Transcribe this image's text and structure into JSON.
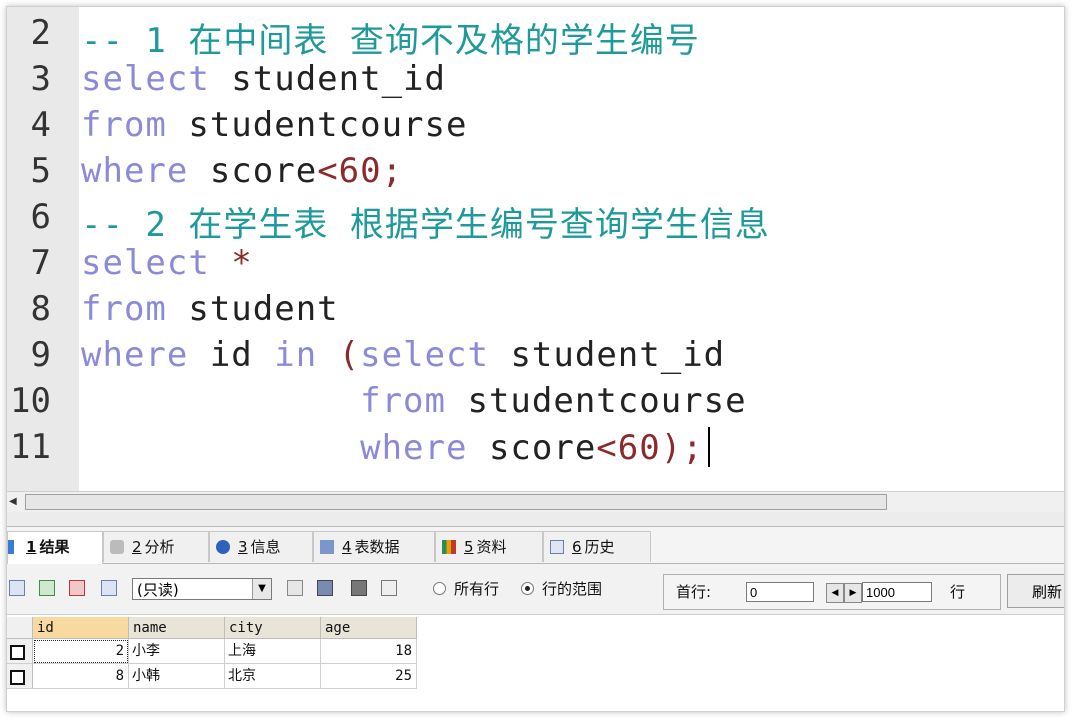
{
  "editor": {
    "lines": [
      {
        "num": "2",
        "tokens": [
          {
            "t": "-- 1 在中间表 查询不及格的学生编号",
            "c": "cm"
          }
        ]
      },
      {
        "num": "3",
        "tokens": [
          {
            "t": "select",
            "c": "kw"
          },
          {
            "t": " student_id",
            "c": ""
          }
        ]
      },
      {
        "num": "4",
        "tokens": [
          {
            "t": "from",
            "c": "kw"
          },
          {
            "t": " studentcourse",
            "c": ""
          }
        ]
      },
      {
        "num": "5",
        "tokens": [
          {
            "t": "where",
            "c": "kw"
          },
          {
            "t": " score",
            "c": ""
          },
          {
            "t": "<60;",
            "c": "op"
          }
        ]
      },
      {
        "num": "6",
        "tokens": [
          {
            "t": "-- 2 在学生表 根据学生编号查询学生信息",
            "c": "cm"
          }
        ]
      },
      {
        "num": "7",
        "tokens": [
          {
            "t": "select",
            "c": "kw"
          },
          {
            "t": " *",
            "c": "op"
          }
        ]
      },
      {
        "num": "8",
        "tokens": [
          {
            "t": "from",
            "c": "kw"
          },
          {
            "t": " student",
            "c": ""
          }
        ]
      },
      {
        "num": "9",
        "tokens": [
          {
            "t": "where",
            "c": "kw"
          },
          {
            "t": " id ",
            "c": ""
          },
          {
            "t": "in",
            "c": "kw"
          },
          {
            "t": " (",
            "c": "op"
          },
          {
            "t": "select",
            "c": "kw"
          },
          {
            "t": " student_id",
            "c": ""
          }
        ]
      },
      {
        "num": "10",
        "tokens": [
          {
            "t": "             ",
            "c": ""
          },
          {
            "t": "from",
            "c": "kw"
          },
          {
            "t": " studentcourse",
            "c": ""
          }
        ]
      },
      {
        "num": "11",
        "tokens": [
          {
            "t": "             ",
            "c": ""
          },
          {
            "t": "where",
            "c": "kw"
          },
          {
            "t": " score",
            "c": ""
          },
          {
            "t": "<60);",
            "c": "op"
          }
        ]
      }
    ]
  },
  "tabs": {
    "t1": {
      "key": "1",
      "label": "结果"
    },
    "t2": {
      "key": "2",
      "label": "分析"
    },
    "t3": {
      "key": "3",
      "label": "信息"
    },
    "t4": {
      "key": "4",
      "label": "表数据"
    },
    "t5": {
      "key": "5",
      "label": "资料"
    },
    "t6": {
      "key": "6",
      "label": "历史"
    }
  },
  "toolbar": {
    "mode_select": "(只读)",
    "radio_all_rows": "所有行",
    "radio_row_range": "行的范围",
    "first_row_label": "首行:",
    "first_row_value": "0",
    "row_count_value": "1000",
    "rows_suffix": "行",
    "refresh_label": "刷新"
  },
  "grid": {
    "columns": [
      "id",
      "name",
      "city",
      "age"
    ],
    "rows": [
      {
        "id": "2",
        "name": "小李",
        "city": "上海",
        "age": "18"
      },
      {
        "id": "8",
        "name": "小韩",
        "city": "北京",
        "age": "25"
      }
    ]
  }
}
